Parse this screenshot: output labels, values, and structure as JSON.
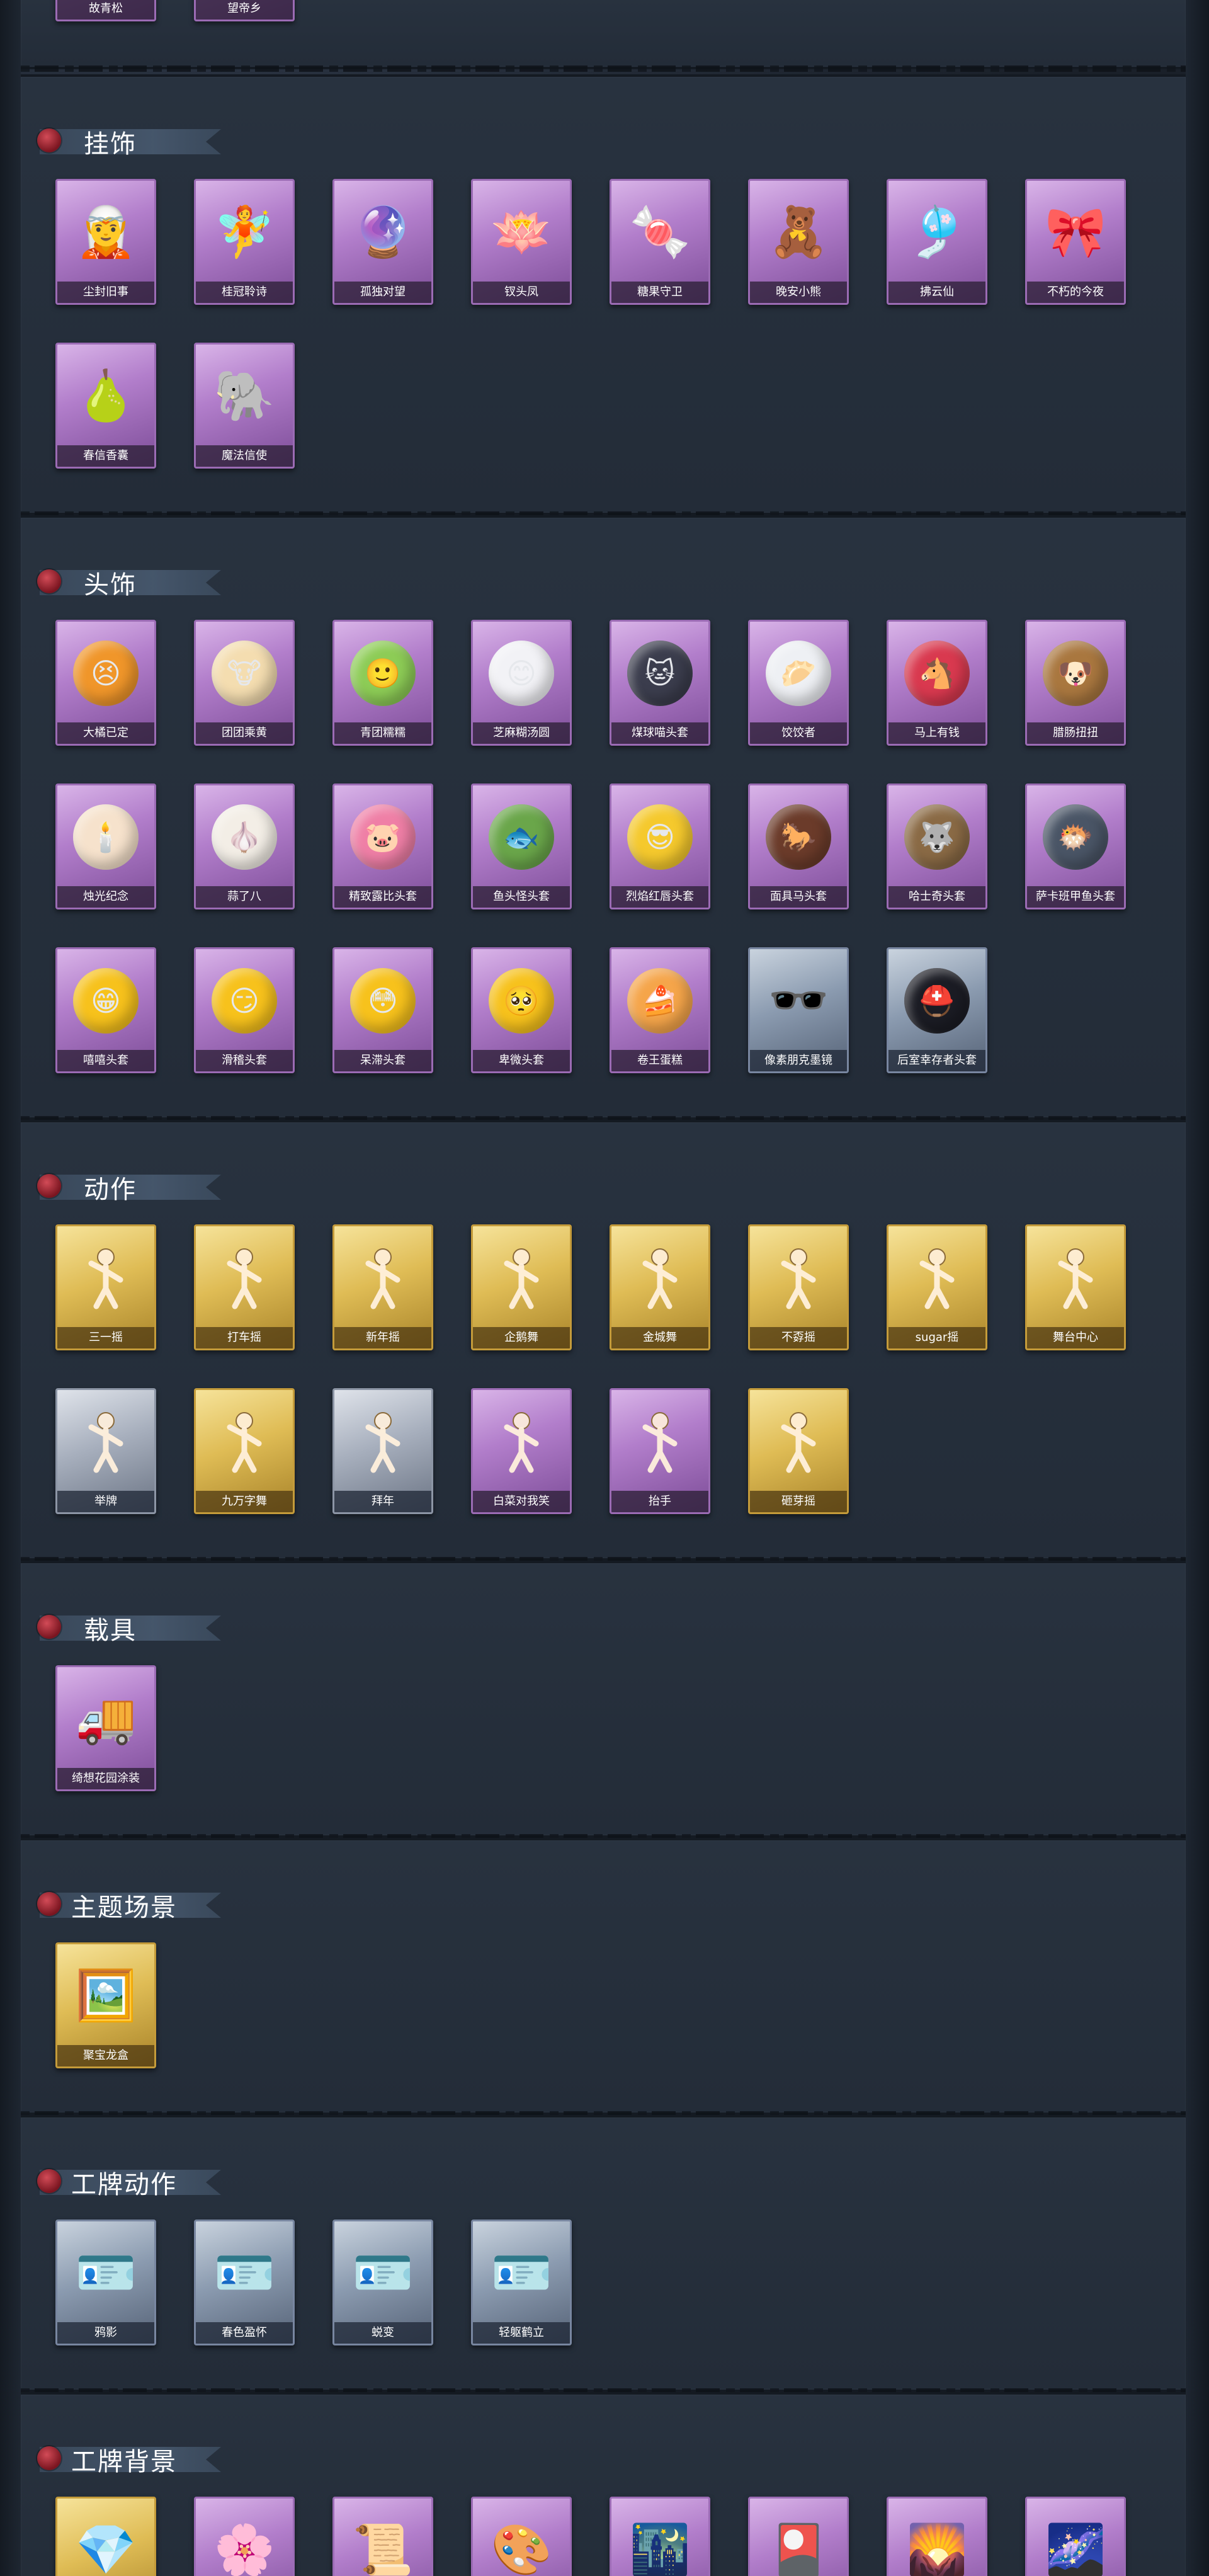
{
  "top_partial": {
    "items": [
      "故青松",
      "望帝乡"
    ]
  },
  "sections": {
    "pendants": {
      "title": "挂饰",
      "items": [
        "尘封旧事",
        "桂冠聆诗",
        "孤独对望",
        "钗头凤",
        "糖果守卫",
        "晚安小熊",
        "拂云仙",
        "不朽的今夜",
        "春信香囊",
        "魔法信使"
      ]
    },
    "headwear": {
      "title": "头饰",
      "items": [
        "大橘已定",
        "团团乘黄",
        "青团糯糯",
        "芝麻糊汤圆",
        "煤球喵头套",
        "饺饺者",
        "马上有钱",
        "腊肠扭扭",
        "烛光纪念",
        "蒜了八",
        "精致露比头套",
        "鱼头怪头套",
        "烈焰红唇头套",
        "面具马头套",
        "哈士奇头套",
        "萨卡班甲鱼头套",
        "嘻嘻头套",
        "滑稽头套",
        "呆滞头套",
        "卑微头套",
        "卷王蛋糕",
        "像素朋克墨镜",
        "后室幸存者头套"
      ]
    },
    "actions": {
      "title": "动作",
      "items": [
        "三一摇",
        "打车摇",
        "新年摇",
        "企鹅舞",
        "金城舞",
        "不孬摇",
        "sugar摇",
        "舞台中心",
        "举牌",
        "九万字舞",
        "拜年",
        "白菜对我笑",
        "抬手",
        "砸芽摇"
      ]
    },
    "vehicle": {
      "title": "载具",
      "items": [
        "绮想花园涂装"
      ]
    },
    "scene": {
      "title": "主题场景",
      "items": [
        "聚宝龙盒"
      ]
    },
    "badge_actions": {
      "title": "工牌动作",
      "items": [
        "鸦影",
        "春色盈怀",
        "蜕变",
        "轻躯鹤立"
      ]
    },
    "badge_bg": {
      "title": "工牌背景"
    }
  },
  "colors": {
    "background": "#1a2029",
    "panel": "#28323f",
    "rarity_purple": "#b27ecb",
    "rarity_gold": "#dfbc55",
    "rarity_blue": "#8b9bb0",
    "header_flag": "#4a5c72",
    "seal_red": "#b02a36"
  }
}
